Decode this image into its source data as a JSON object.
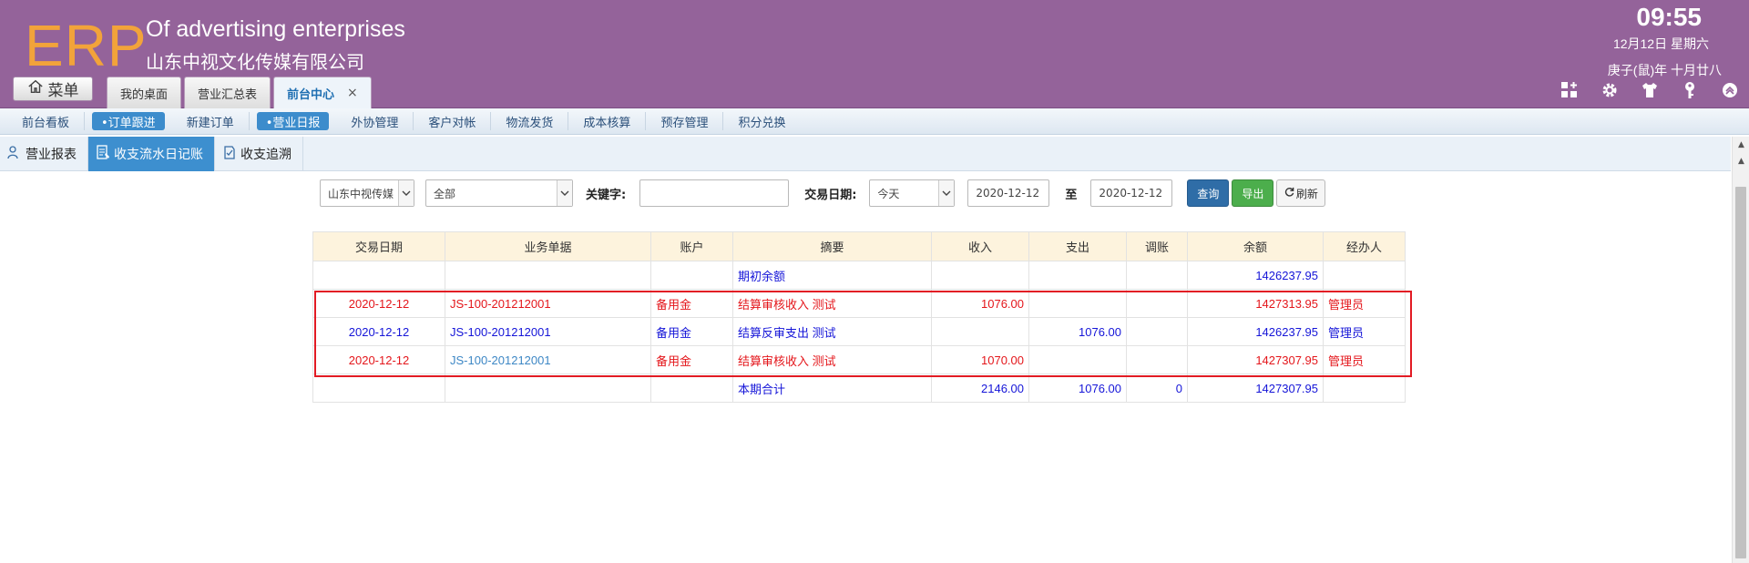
{
  "header": {
    "logo": "ERP",
    "brand_en": "Of advertising enterprises",
    "brand_cn": "山东中视文化传媒有限公司",
    "time": "09:55",
    "date": "12月12日 星期六",
    "lunar": "庚子(鼠)年 十月廿八",
    "menu_label": "菜单",
    "tabs": [
      {
        "label": "我的桌面"
      },
      {
        "label": "营业汇总表"
      },
      {
        "label": "前台中心",
        "close": "×"
      }
    ],
    "tool_icons": [
      "grid-add-icon",
      "gear-icon",
      "shirt-icon",
      "key-icon",
      "collapse-up-icon"
    ]
  },
  "nav": {
    "items": [
      "前台看板",
      "•订单跟进",
      "新建订单",
      "•营业日报",
      "外协管理",
      "客户对帐",
      "物流发货",
      "成本核算",
      "预存管理",
      "积分兑换"
    ]
  },
  "subtabs": [
    {
      "label": "营业报表",
      "icon": "people-icon"
    },
    {
      "label": "收支流水日记账",
      "icon": "ledger-icon"
    },
    {
      "label": "收支追溯",
      "icon": "trace-icon"
    }
  ],
  "filter": {
    "company": "山东中视传媒",
    "category": "全部",
    "keyword_label": "关键字:",
    "keyword_value": "",
    "date_label": "交易日期:",
    "date_range": "今天",
    "date_from": "2020-12-12",
    "to_label": "至",
    "date_to": "2020-12-12",
    "query": "查询",
    "export": "导出",
    "refresh": "刷新"
  },
  "table": {
    "columns": [
      "交易日期",
      "业务单据",
      "账户",
      "摘要",
      "收入",
      "支出",
      "调账",
      "余额",
      "经办人"
    ],
    "opening": {
      "summary": "期初余额",
      "balance": "1426237.95"
    },
    "rows": [
      {
        "date": "2020-12-12",
        "doc": "JS-100-201212001",
        "account": "备用金",
        "summary": "结算审核收入 测试",
        "income": "1076.00",
        "expense": "",
        "adjust": "",
        "balance": "1427313.95",
        "handler": "管理员",
        "color": "red"
      },
      {
        "date": "2020-12-12",
        "doc": "JS-100-201212001",
        "account": "备用金",
        "summary": "结算反审支出 测试",
        "income": "",
        "expense": "1076.00",
        "adjust": "",
        "balance": "1426237.95",
        "handler": "管理员",
        "color": "blue"
      },
      {
        "date": "2020-12-12",
        "doc": "JS-100-201212001",
        "account": "备用金",
        "summary": "结算审核收入 测试",
        "income": "1070.00",
        "expense": "",
        "adjust": "",
        "balance": "1427307.95",
        "handler": "管理员",
        "color": "red"
      }
    ],
    "total": {
      "summary": "本期合计",
      "income": "2146.00",
      "expense": "1076.00",
      "adjust": "0",
      "balance": "1427307.95"
    }
  }
}
